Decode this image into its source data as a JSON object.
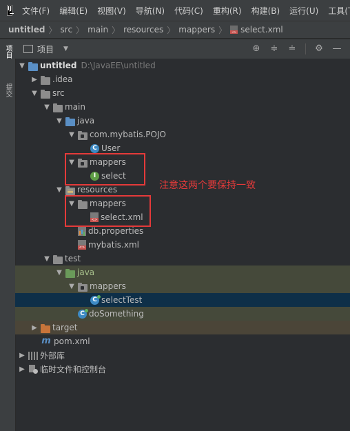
{
  "menubar": {
    "logo_text": "IJ",
    "items": [
      "文件(F)",
      "编辑(E)",
      "视图(V)",
      "导航(N)",
      "代码(C)",
      "重构(R)",
      "构建(B)",
      "运行(U)",
      "工具(T)"
    ]
  },
  "breadcrumb": {
    "items": [
      "untitled",
      "src",
      "main",
      "resources",
      "mappers",
      "select.xml"
    ]
  },
  "side_tabs": {
    "project": "项目",
    "commit": "提交"
  },
  "project_panel": {
    "title": "项目",
    "tools": [
      "crosshair-icon",
      "expand-all-icon",
      "collapse-all-icon",
      "gear-icon",
      "minimize-icon"
    ]
  },
  "tree": {
    "root_label": "untitled",
    "root_path": "D:\\JavaEE\\untitled",
    "idea": ".idea",
    "src": "src",
    "main": "main",
    "java": "java",
    "pojo_pkg": "com.mybatis.POJO",
    "user": "User",
    "mappers_java": "mappers",
    "select_iface": "select",
    "resources": "resources",
    "mappers_res": "mappers",
    "select_xml": "select.xml",
    "db_props": "db.properties",
    "mybatis_xml": "mybatis.xml",
    "test": "test",
    "test_java": "java",
    "test_mappers": "mappers",
    "select_test": "selectTest",
    "do_something": "doSomething",
    "target": "target",
    "pom": "pom.xml",
    "ext_libs": "外部库",
    "scratches": "临时文件和控制台"
  },
  "annotation": "注意这两个要保持一致",
  "colors": {
    "annotation_red": "#e53a3a",
    "selection": "#0e2f48",
    "test_source_bg": "#45493a"
  }
}
